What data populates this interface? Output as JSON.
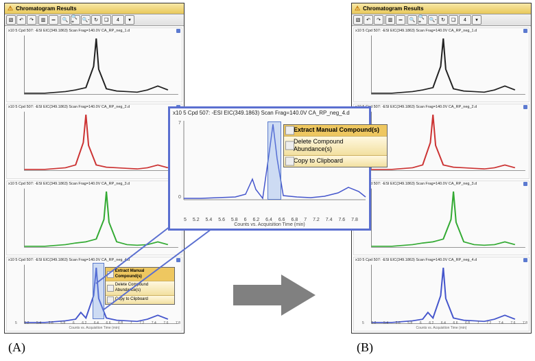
{
  "panelTitle": "Chromatogram Results",
  "toolbar": {
    "btnSel": "▧",
    "undo": "↶",
    "redo": "↷",
    "chartBtn": "▥",
    "ruler": "═",
    "zoom": "🔍",
    "zoomIn": "🔍+",
    "zoomOut": "🔍-",
    "refresh": "↻",
    "qmark": "❏",
    "num": "4",
    "dd": "▾"
  },
  "charts": [
    {
      "title": "Cpd 507: -ESI EIC(349.1863) Scan Frag=140.0V CA_RP_neg_1.d",
      "ylab": "x10 5"
    },
    {
      "title": "Cpd 507: -ESI EIC(349.1863) Scan Frag=140.0V CA_RP_neg_2.d",
      "ylab": "x10 5"
    },
    {
      "title": "Cpd 507: -ESI EIC(349.1863) Scan Frag=140.0V CA_RP_neg_3.d",
      "ylab": "x10 5"
    },
    {
      "title": "Cpd 507: -ESI EIC(349.1863) Scan Frag=140.0V CA_RP_neg_4.d",
      "ylab": "x10 5"
    }
  ],
  "xticks": [
    "5",
    "5.2",
    "5.4",
    "5.6",
    "5.8",
    "6",
    "6.2",
    "6.4",
    "6.6",
    "6.8",
    "7",
    "7.2",
    "7.4",
    "7.6",
    "7.8"
  ],
  "xlabel": "Counts vs. Acquisition Time (min)",
  "menu": {
    "extract": "Extract Manual Compound(s)",
    "delete": "Delete Compound Abundance(s)",
    "copy": "Copy to Clipboard"
  },
  "popupTitle": "x10 5  Cpd 507: -ESI EIC(349.1863) Scan Frag=140.0V CA_RP_neg_4.d",
  "popupXticks": [
    "5",
    "5.2",
    "5.4",
    "5.6",
    "5.8",
    "6",
    "6.2",
    "6.4",
    "6.6",
    "6.8",
    "7",
    "7.2",
    "7.4",
    "7.6",
    "7.8"
  ],
  "labelA": "(A)",
  "labelB": "(B)",
  "chart_data": {
    "type": "line",
    "xlabel": "Acquisition Time (min)",
    "ylabel": "Counts",
    "xlim": [
      5,
      8
    ],
    "series": [
      {
        "name": "CA_RP_neg_1.d",
        "color": "#222222",
        "x": [
          5,
          5.4,
          5.8,
          6.0,
          6.2,
          6.35,
          6.4,
          6.45,
          6.6,
          6.8,
          7.0,
          7.2,
          7.4,
          7.6,
          7.8
        ],
        "y": [
          0.02,
          0.02,
          0.05,
          0.08,
          0.12,
          0.5,
          1.0,
          0.45,
          0.1,
          0.06,
          0.05,
          0.04,
          0.08,
          0.15,
          0.08
        ]
      },
      {
        "name": "CA_RP_neg_2.d",
        "color": "#cc3333",
        "x": [
          5,
          5.4,
          5.8,
          6.0,
          6.15,
          6.2,
          6.25,
          6.4,
          6.6,
          6.8,
          7.0,
          7.2,
          7.4,
          7.6,
          7.8
        ],
        "y": [
          0.02,
          0.02,
          0.05,
          0.1,
          0.5,
          1.0,
          0.45,
          0.1,
          0.06,
          0.05,
          0.04,
          0.03,
          0.05,
          0.1,
          0.05
        ]
      },
      {
        "name": "CA_RP_neg_3.d",
        "color": "#33aa33",
        "x": [
          5,
          5.4,
          5.8,
          6.0,
          6.2,
          6.4,
          6.55,
          6.6,
          6.65,
          6.8,
          7.0,
          7.2,
          7.4,
          7.6,
          7.8
        ],
        "y": [
          0.02,
          0.02,
          0.05,
          0.08,
          0.1,
          0.15,
          0.5,
          1.0,
          0.45,
          0.1,
          0.05,
          0.04,
          0.05,
          0.1,
          0.05
        ]
      },
      {
        "name": "CA_RP_neg_4.d",
        "color": "#4455cc",
        "x": [
          5,
          5.4,
          5.8,
          6.0,
          6.1,
          6.2,
          6.35,
          6.4,
          6.45,
          6.6,
          6.8,
          7.0,
          7.2,
          7.4,
          7.6,
          7.8
        ],
        "y": [
          0.02,
          0.02,
          0.05,
          0.08,
          0.2,
          0.1,
          0.5,
          1.0,
          0.45,
          0.1,
          0.06,
          0.05,
          0.04,
          0.08,
          0.15,
          0.08
        ]
      }
    ],
    "highlighted_region_min": [
      6.3,
      6.5
    ]
  }
}
